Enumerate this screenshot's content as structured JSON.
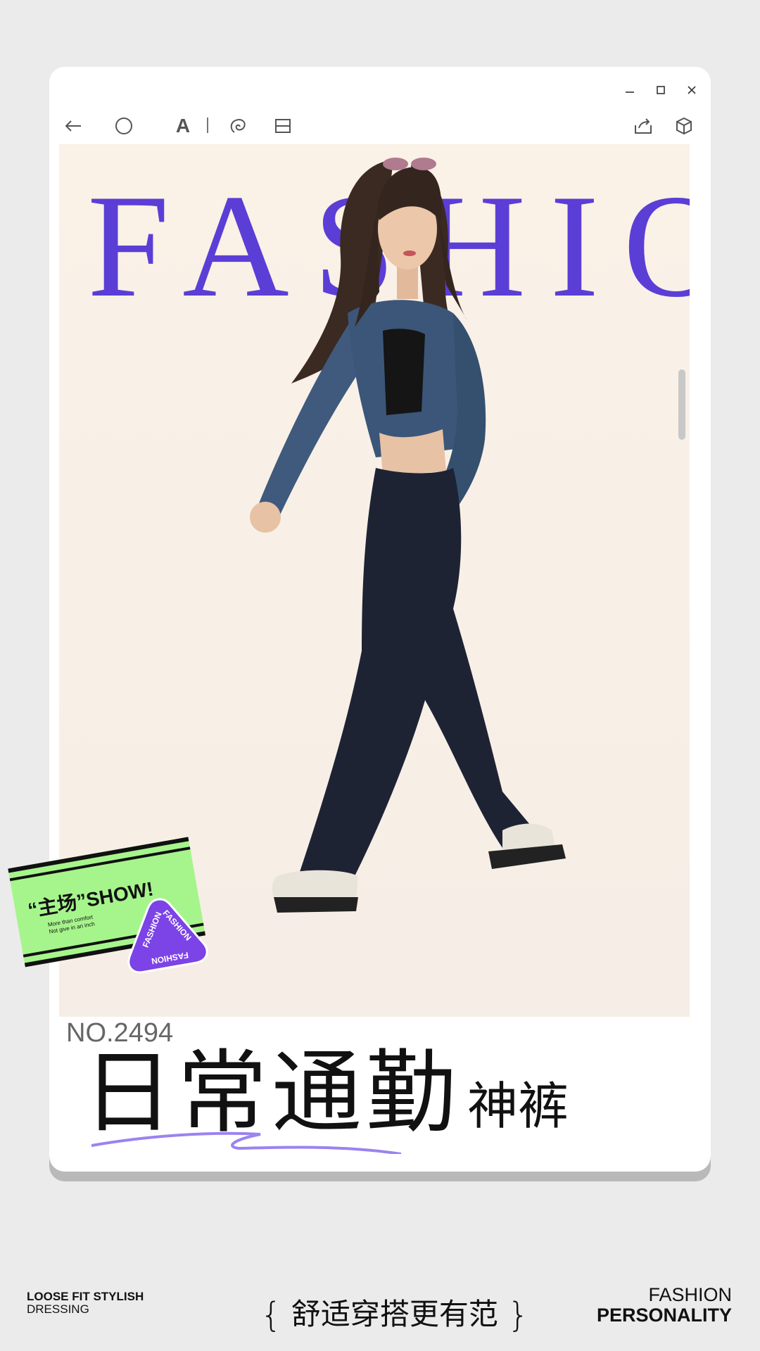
{
  "window": {
    "controls": [
      "minimize",
      "maximize",
      "close"
    ]
  },
  "toolbar": {
    "tools": [
      {
        "id": "back",
        "icon": "arrow-left-icon"
      },
      {
        "id": "shape",
        "icon": "circle-icon"
      },
      {
        "id": "text",
        "icon": "text-icon",
        "label": "A"
      },
      {
        "id": "lasso",
        "icon": "lasso-icon"
      },
      {
        "id": "layout",
        "icon": "layout-icon"
      },
      {
        "id": "share",
        "icon": "share-icon"
      },
      {
        "id": "3d",
        "icon": "cube-icon"
      }
    ]
  },
  "poster": {
    "hero_title": "FASHION",
    "accent_color": "#5b3ed6",
    "sticker": {
      "main": "“主场”SHOW!",
      "sub_line1": "More than comfort",
      "sub_line2": "Not give in an inch",
      "badge_text": "FASHION",
      "background_color": "#a6f58c"
    },
    "number": "NO.2494",
    "cn_title_big": "日常通勤",
    "cn_title_small": "神裤"
  },
  "footer": {
    "left_line1": "LOOSE FIT STYLISH",
    "left_line2": "DRESSING",
    "center_text": "舒适穿搭更有范",
    "right_line1": "FASHION",
    "right_line2": "PERSONALITY"
  }
}
